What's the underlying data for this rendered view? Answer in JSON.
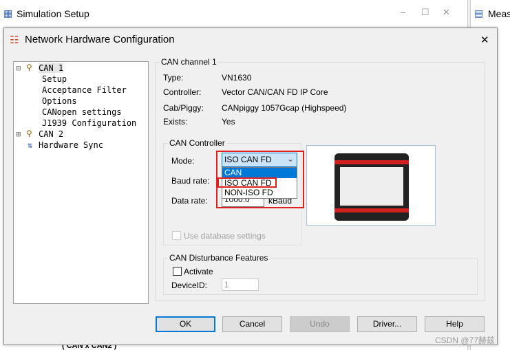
{
  "outer_window": {
    "title": "Simulation Setup",
    "minimize": "–",
    "maximize": "☐",
    "close": "✕"
  },
  "side_window": {
    "title": "Meas"
  },
  "dialog": {
    "title": "Network Hardware Configuration",
    "close": "✕"
  },
  "tree": {
    "items": [
      {
        "label": "CAN 1",
        "expander": "⊟"
      },
      {
        "label": "Setup"
      },
      {
        "label": "Acceptance Filter"
      },
      {
        "label": "Options"
      },
      {
        "label": "CANopen settings"
      },
      {
        "label": "J1939 Configuration"
      },
      {
        "label": "CAN 2",
        "expander": "⊞"
      },
      {
        "label": "Hardware Sync"
      }
    ]
  },
  "channel": {
    "group_label": "CAN channel 1",
    "rows": [
      {
        "label": "Type:",
        "value": "VN1630"
      },
      {
        "label": "Controller:",
        "value": "Vector CAN/CAN FD IP Core"
      },
      {
        "label": "Cab/Piggy:",
        "value": "CANpiggy 1057Gcap (Highspeed)"
      },
      {
        "label": "Exists:",
        "value": "Yes"
      }
    ]
  },
  "controller": {
    "group_label": "CAN Controller",
    "mode_label": "Mode:",
    "mode_value": "ISO CAN FD",
    "mode_options": [
      "CAN",
      "ISO CAN FD",
      "NON-ISO FD"
    ],
    "baud_label": "Baud rate:",
    "data_label": "Data rate:",
    "data_value": "1000.0",
    "data_unit": "kBaud",
    "use_db": "Use database settings"
  },
  "disturbance": {
    "group_label": "CAN Disturbance Features",
    "activate": "Activate",
    "device_label": "DeviceID:",
    "device_value": "1"
  },
  "buttons": {
    "ok": "OK",
    "cancel": "Cancel",
    "undo": "Undo",
    "driver": "Driver...",
    "help": "Help"
  },
  "background_text": "( CAN x CAN2 )",
  "watermark": "CSDN @77赫兹",
  "colors": {
    "highlight": "#0078d7",
    "annotation": "#e0201f"
  }
}
